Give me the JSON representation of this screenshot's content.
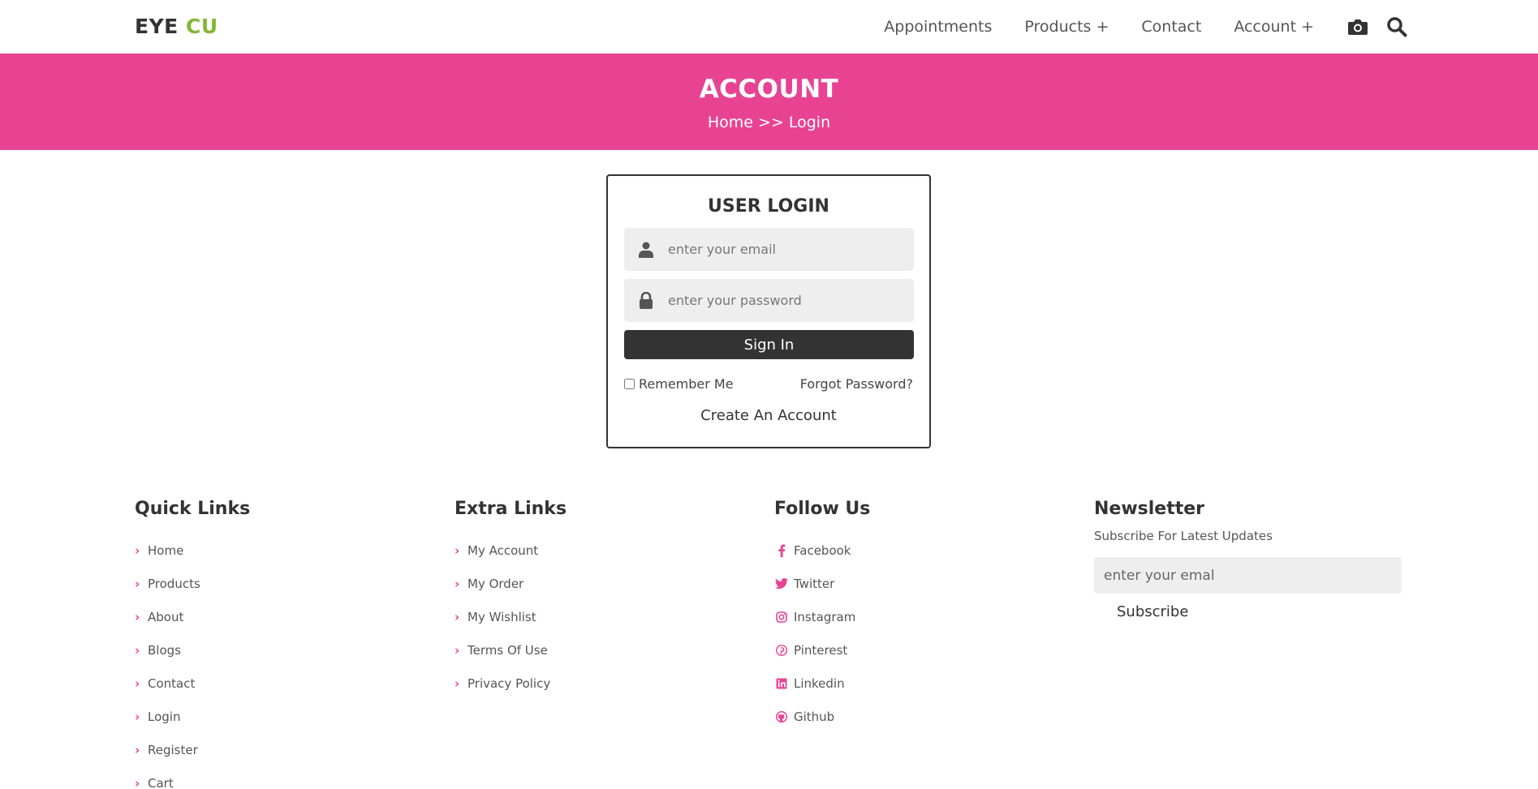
{
  "header": {
    "logo_main": "EYE",
    "logo_accent": "CU",
    "nav": [
      "Appointments",
      "Products +",
      "Contact",
      "Account +"
    ],
    "icons": [
      "camera-icon",
      "search-icon"
    ]
  },
  "banner": {
    "title": "ACCOUNT",
    "breadcrumb": "Home >> Login"
  },
  "login": {
    "title": "USER LOGIN",
    "email_placeholder": "enter your email",
    "password_placeholder": "enter your password",
    "signin_label": "Sign In",
    "remember_label": "Remember Me",
    "forgot_label": "Forgot Password?",
    "create_label": "Create An Account"
  },
  "footer": {
    "quick": {
      "title": "Quick Links",
      "items": [
        "Home",
        "Products",
        "About",
        "Blogs",
        "Contact",
        "Login",
        "Register",
        "Cart"
      ]
    },
    "extra": {
      "title": "Extra Links",
      "items": [
        "My Account",
        "My Order",
        "My Wishlist",
        "Terms Of Use",
        "Privacy Policy"
      ]
    },
    "follow": {
      "title": "Follow Us",
      "items": [
        "Facebook",
        "Twitter",
        "Instagram",
        "Pinterest",
        "Linkedin",
        "Github"
      ]
    },
    "newsletter": {
      "title": "Newsletter",
      "subtitle": "Subscribe For Latest Updates",
      "placeholder": "enter your emal",
      "button": "Subscribe"
    }
  },
  "colors": {
    "accent_pink": "#e84393",
    "logo_green": "#83b736",
    "dark": "#333333"
  }
}
